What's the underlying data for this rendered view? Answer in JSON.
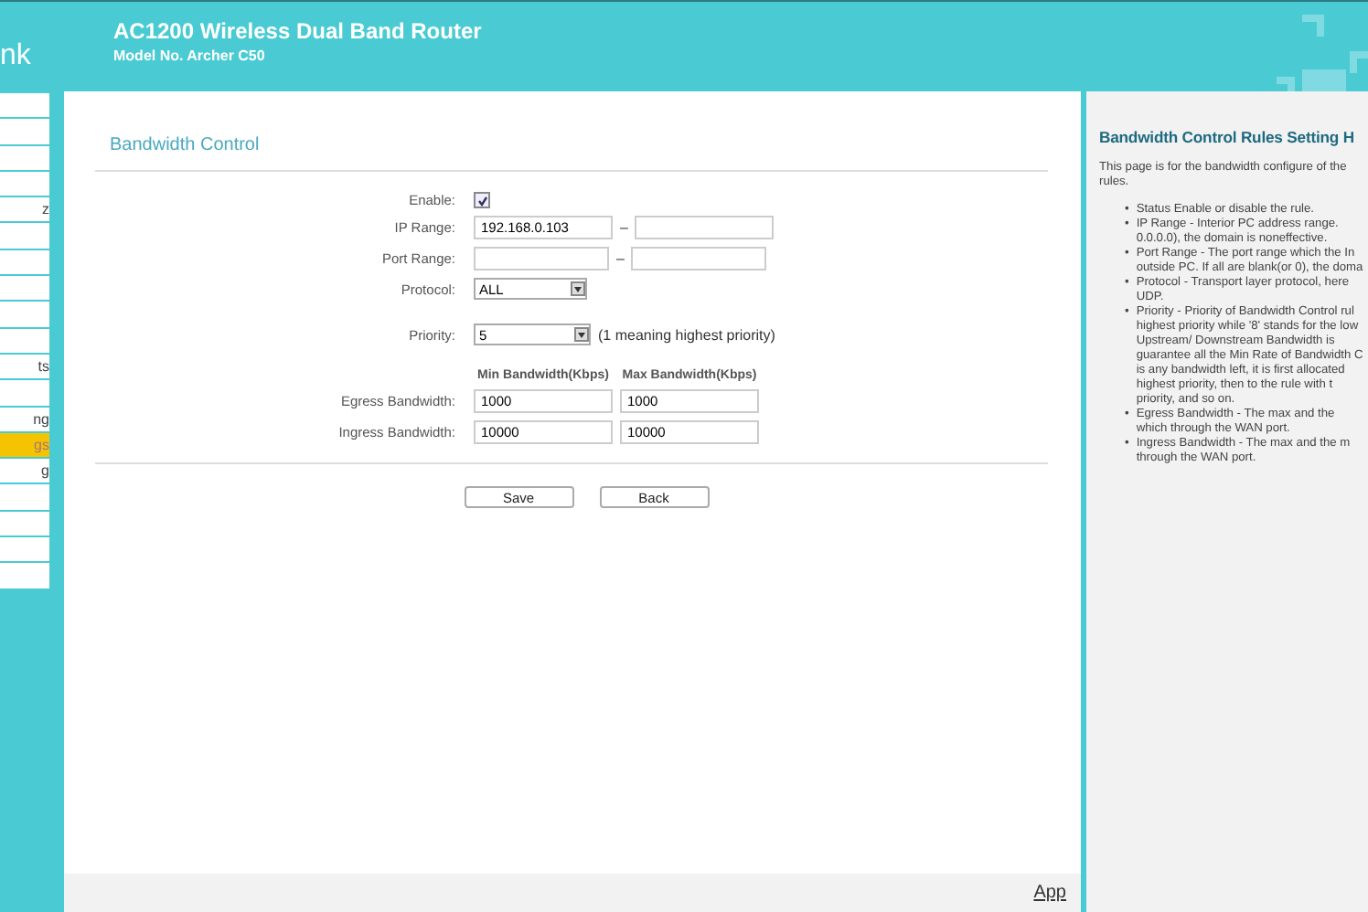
{
  "header": {
    "logo": "nk",
    "title": "AC1200 Wireless Dual Band Router",
    "model": "Model No. Archer C50"
  },
  "sidebar": {
    "items": [
      {
        "selected": false
      },
      {
        "selected": false
      },
      {
        "selected": false
      },
      {
        "selected": false
      },
      {
        "label": "z",
        "selected": false
      },
      {
        "selected": false
      },
      {
        "selected": false
      },
      {
        "selected": false
      },
      {
        "selected": false
      },
      {
        "selected": false
      },
      {
        "label": "ts",
        "selected": false
      },
      {
        "selected": false
      },
      {
        "label": "ng",
        "selected": false
      },
      {
        "label": "gs",
        "selected": true
      },
      {
        "label": "g",
        "selected": false
      },
      {
        "selected": false
      },
      {
        "selected": false
      },
      {
        "selected": false
      },
      {
        "selected": false
      }
    ]
  },
  "form": {
    "title": "Bandwidth Control",
    "enable": {
      "label": "Enable:",
      "checked": true
    },
    "ip_range": {
      "label": "IP Range:",
      "from": "192.168.0.103",
      "separator": "–"
    },
    "port_range": {
      "label": "Port Range:",
      "separator": "–"
    },
    "protocol": {
      "label": "Protocol:",
      "value": "ALL"
    },
    "priority": {
      "label": "Priority:",
      "value": "5",
      "hint": "(1 meaning highest priority)"
    },
    "columns": [
      "Min Bandwidth(Kbps)",
      "Max Bandwidth(Kbps)"
    ],
    "rows": [
      {
        "label": "Egress Bandwidth:",
        "min": "1000",
        "max": "1000"
      },
      {
        "label": "Ingress Bandwidth:",
        "min": "10000",
        "max": "10000"
      }
    ],
    "buttons": [
      "Save",
      "Back"
    ]
  },
  "footer": {
    "link": "App"
  },
  "help": {
    "title": "Bandwidth Control Rules Setting H",
    "intro": [
      "This page is for the bandwidth configure of the",
      "rules."
    ],
    "bullets": [
      {
        "marker": "•",
        "lines": [
          "Status Enable or disable the rule."
        ]
      },
      {
        "marker": "•",
        "lines": [
          "IP Range - Interior PC address range.",
          "0.0.0.0), the domain is noneffective."
        ]
      },
      {
        "marker": "•",
        "lines": [
          "Port Range - The port range which the In",
          "outside PC. If all are blank(or 0), the doma"
        ]
      },
      {
        "marker": "•",
        "lines": [
          "Protocol - Transport layer protocol, here",
          "UDP."
        ]
      },
      {
        "marker": "•",
        "lines": [
          "Priority - Priority of Bandwidth Control rul",
          "highest priority while '8' stands for the low",
          "Upstream/ Downstream Bandwidth is",
          "guarantee all the Min Rate of Bandwidth C",
          "is any bandwidth left, it is first allocated",
          "highest priority, then to the rule with t",
          "priority, and so on."
        ]
      },
      {
        "marker": "•",
        "lines": [
          "Egress Bandwidth - The max and the",
          "which through the WAN port."
        ]
      },
      {
        "marker": "•",
        "lines": [
          "Ingress Bandwidth - The max and the m",
          "through the WAN port."
        ]
      }
    ]
  }
}
